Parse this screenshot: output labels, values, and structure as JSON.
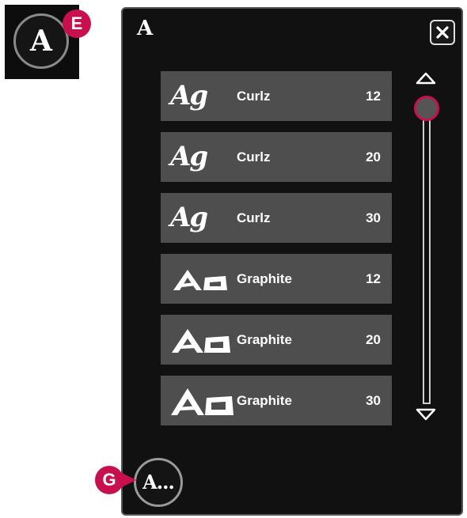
{
  "font_button": {
    "letter": "A"
  },
  "markers": {
    "e": "E",
    "g": "G"
  },
  "panel": {
    "title": "A",
    "close_icon": "close-icon",
    "scroll_up_icon": "triangle-up-icon",
    "scroll_down_icon": "triangle-down-icon",
    "all_fonts_label": "A..."
  },
  "fonts": [
    {
      "sample": "Ag",
      "name": "Curlz",
      "size": "12",
      "style": "curlz"
    },
    {
      "sample": "Ag",
      "name": "Curlz",
      "size": "20",
      "style": "curlz"
    },
    {
      "sample": "Ag",
      "name": "Curlz",
      "size": "30",
      "style": "curlz"
    },
    {
      "sample": "Aa",
      "name": "Graphite",
      "size": "12",
      "style": "graphite"
    },
    {
      "sample": "Aa",
      "name": "Graphite",
      "size": "20",
      "style": "graphite"
    },
    {
      "sample": "Aa",
      "name": "Graphite",
      "size": "30",
      "style": "graphite"
    }
  ],
  "colors": {
    "accent": "#c8104e",
    "panel_bg": "#111111",
    "row_bg": "#4e4e4e"
  }
}
